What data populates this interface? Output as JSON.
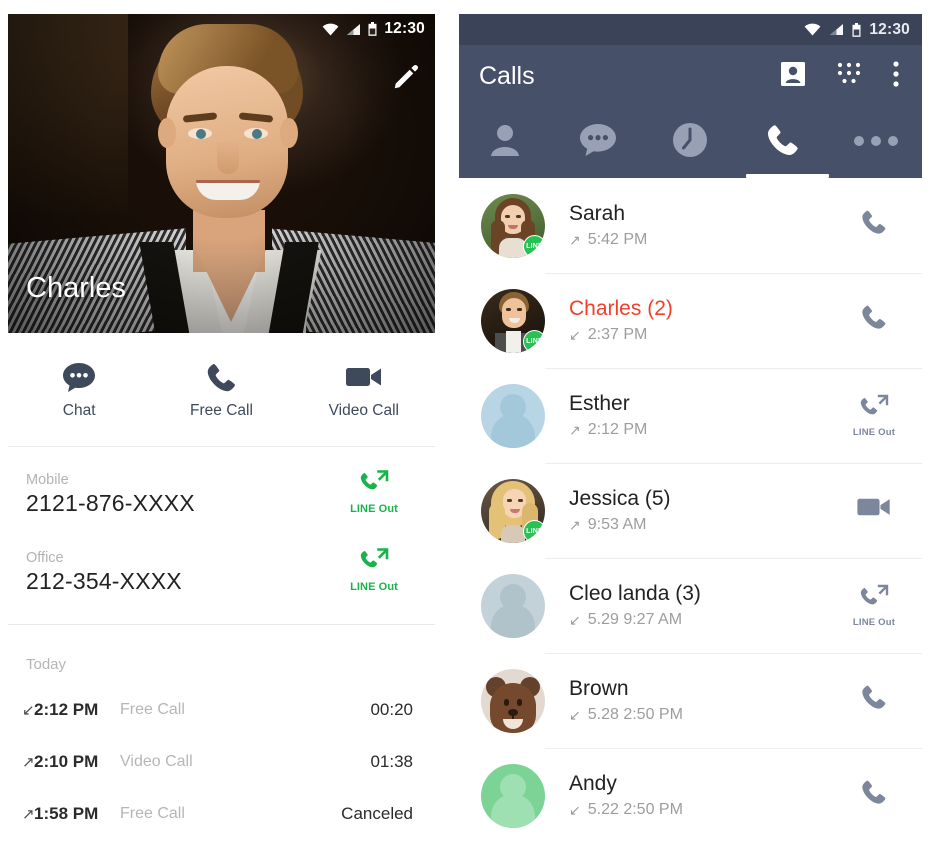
{
  "left_panel": {
    "status_bar": {
      "time": "12:30",
      "icons": [
        "wifi-icon",
        "signal-icon",
        "battery-icon"
      ]
    },
    "edit_icon": "edit-pencil-icon",
    "contact_name": "Charles",
    "actions": [
      {
        "icon": "chat-bubble-icon",
        "label": "Chat"
      },
      {
        "icon": "phone-icon",
        "label": "Free Call"
      },
      {
        "icon": "video-camera-icon",
        "label": "Video Call"
      }
    ],
    "phones": [
      {
        "label": "Mobile",
        "number": "2121-876-XXXX",
        "action_icon": "phone-out-icon",
        "action_label": "LINE Out"
      },
      {
        "label": "Office",
        "number": "212-354-XXXX",
        "action_icon": "phone-out-icon",
        "action_label": "LINE Out"
      }
    ],
    "history_title": "Today",
    "history": [
      {
        "direction": "incoming",
        "arrow": "↙",
        "time": "2:12 PM",
        "type": "Free Call",
        "duration": "00:20"
      },
      {
        "direction": "outgoing",
        "arrow": "↗",
        "time": "2:10 PM",
        "type": "Video Call",
        "duration": "01:38"
      },
      {
        "direction": "outgoing",
        "arrow": "↗",
        "time": "1:58 PM",
        "type": "Free Call",
        "duration": "Canceled"
      }
    ]
  },
  "right_panel": {
    "status_bar": {
      "time": "12:30",
      "icons": [
        "wifi-icon",
        "signal-icon",
        "battery-icon"
      ]
    },
    "header": {
      "title": "Calls",
      "icons": [
        "contact-card-icon",
        "dialpad-icon",
        "overflow-menu-icon"
      ]
    },
    "tabs": [
      {
        "name": "friends",
        "icon": "person-icon",
        "active": false
      },
      {
        "name": "chats",
        "icon": "chat-bubble-icon",
        "active": false
      },
      {
        "name": "timeline",
        "icon": "clock-icon",
        "active": false
      },
      {
        "name": "calls",
        "icon": "phone-icon",
        "active": true
      },
      {
        "name": "more",
        "icon": "more-dots-icon",
        "active": false
      }
    ],
    "calls": [
      {
        "name": "Sarah",
        "missed": false,
        "arrow": "↗",
        "time": "5:42 PM",
        "avatar": "photo-woman-brunette",
        "line_badge": "LINE",
        "action_icon": "phone-icon",
        "action_label": ""
      },
      {
        "name": "Charles (2)",
        "missed": true,
        "arrow": "↙",
        "time": "2:37 PM",
        "avatar": "photo-man",
        "line_badge": "LINE",
        "action_icon": "phone-icon",
        "action_label": ""
      },
      {
        "name": "Esther",
        "missed": false,
        "arrow": "↗",
        "time": "2:12 PM",
        "avatar": "placeholder-blue",
        "line_badge": "",
        "action_icon": "phone-out-icon",
        "action_label": "LINE Out"
      },
      {
        "name": "Jessica (5)",
        "missed": false,
        "arrow": "↗",
        "time": "9:53 AM",
        "avatar": "photo-woman-blonde",
        "line_badge": "LINE",
        "action_icon": "video-camera-icon",
        "action_label": ""
      },
      {
        "name": "Cleo landa (3)",
        "missed": false,
        "arrow": "↙",
        "time": "5.29  9:27 AM",
        "avatar": "placeholder-gray",
        "line_badge": "",
        "action_icon": "phone-out-icon",
        "action_label": "LINE Out"
      },
      {
        "name": "Brown",
        "missed": false,
        "arrow": "↙",
        "time": "5.28  2:50 PM",
        "avatar": "bear-character",
        "line_badge": "",
        "action_icon": "phone-icon",
        "action_label": ""
      },
      {
        "name": "Andy",
        "missed": false,
        "arrow": "↙",
        "time": "5.22  2:50 PM",
        "avatar": "placeholder-green",
        "line_badge": "",
        "action_icon": "phone-icon",
        "action_label": ""
      }
    ]
  },
  "colors": {
    "header_navy": "#475069",
    "status_navy": "#3a4358",
    "line_green": "#18b44b",
    "missed_red": "#f0402a",
    "icon_navy": "#3e4a5c",
    "muted_gray": "#b3b3b3"
  }
}
